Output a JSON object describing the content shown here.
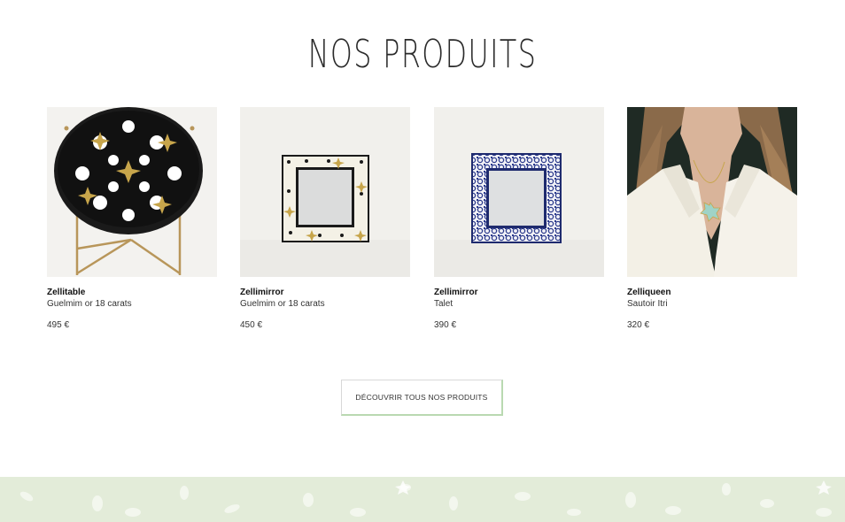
{
  "section": {
    "title": "NOS PRODUITS"
  },
  "products": [
    {
      "name": "Zellitable",
      "variant": "Guelmim or 18 carats",
      "price": "495 €",
      "image_icon": "mosaic-side-table-image"
    },
    {
      "name": "Zellimirror",
      "variant": "Guelmim or 18 carats",
      "price": "450 €",
      "image_icon": "tiled-mirror-image"
    },
    {
      "name": "Zellimirror",
      "variant": "Talet",
      "price": "390 €",
      "image_icon": "blue-tiled-mirror-image"
    },
    {
      "name": "Zelliqueen",
      "variant": "Sautoir Itri",
      "price": "320 €",
      "image_icon": "necklace-model-image"
    }
  ],
  "cta": {
    "label": "DÉCOUVRIR TOUS NOS PRODUITS"
  },
  "colors": {
    "footer_band": "#e3ecd9",
    "button_accent": "#b9d9b1",
    "mirror_blue": "#2b3a8c",
    "gold": "#c7a54b"
  }
}
